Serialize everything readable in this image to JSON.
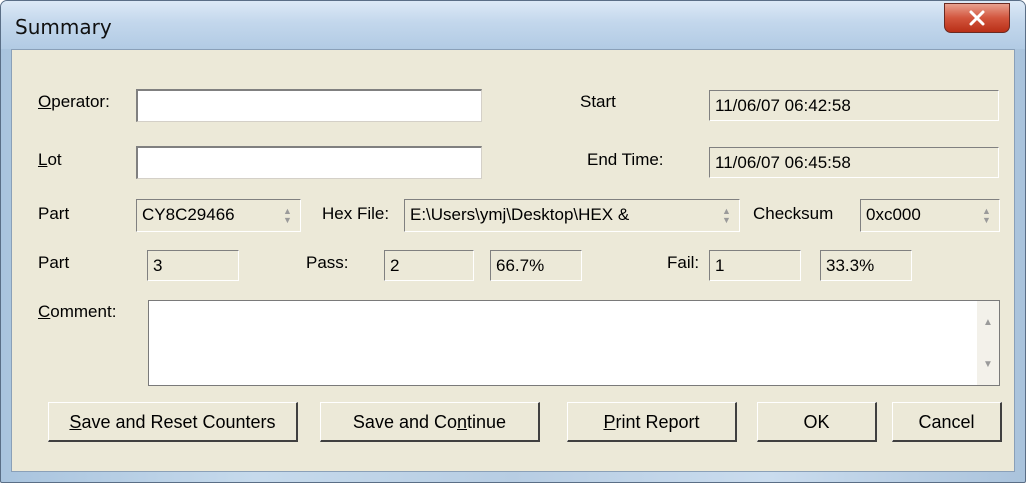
{
  "window": {
    "title": "Summary"
  },
  "fields": {
    "operator": {
      "label_accel": "O",
      "label_rest": "perator:",
      "value": ""
    },
    "lot": {
      "label_accel": "L",
      "label_rest": "ot",
      "value": ""
    },
    "start": {
      "label": "Start",
      "value": "11/06/07  06:42:58"
    },
    "end_time": {
      "label": "End Time:",
      "value": "11/06/07  06:45:58"
    },
    "part": {
      "label": "Part",
      "value": "CY8C29466"
    },
    "hex_file": {
      "label": "Hex File:",
      "value": "E:\\Users\\ymj\\Desktop\\HEX &"
    },
    "checksum": {
      "label": "Checksum",
      "value": "0xc000"
    },
    "part_count": {
      "label": "Part",
      "value": "3"
    },
    "pass": {
      "label": "Pass:",
      "value": "2",
      "percent": "66.7%"
    },
    "fail": {
      "label": "Fail:",
      "value": "1",
      "percent": "33.3%"
    },
    "comment": {
      "label_accel": "C",
      "label_rest": "omment:",
      "value": ""
    }
  },
  "buttons": {
    "save_reset": {
      "accel": "S",
      "rest": "ave and Reset Counters"
    },
    "save_continue": {
      "pre": "Save and Co",
      "accel": "n",
      "post": "tinue"
    },
    "print_report": {
      "accel": "P",
      "rest": "rint Report"
    },
    "ok": "OK",
    "cancel": "Cancel"
  },
  "icons": {
    "close": "close-x-icon",
    "spin": "spin-arrows-icon",
    "scroll": "scroll-arrows-icon"
  }
}
